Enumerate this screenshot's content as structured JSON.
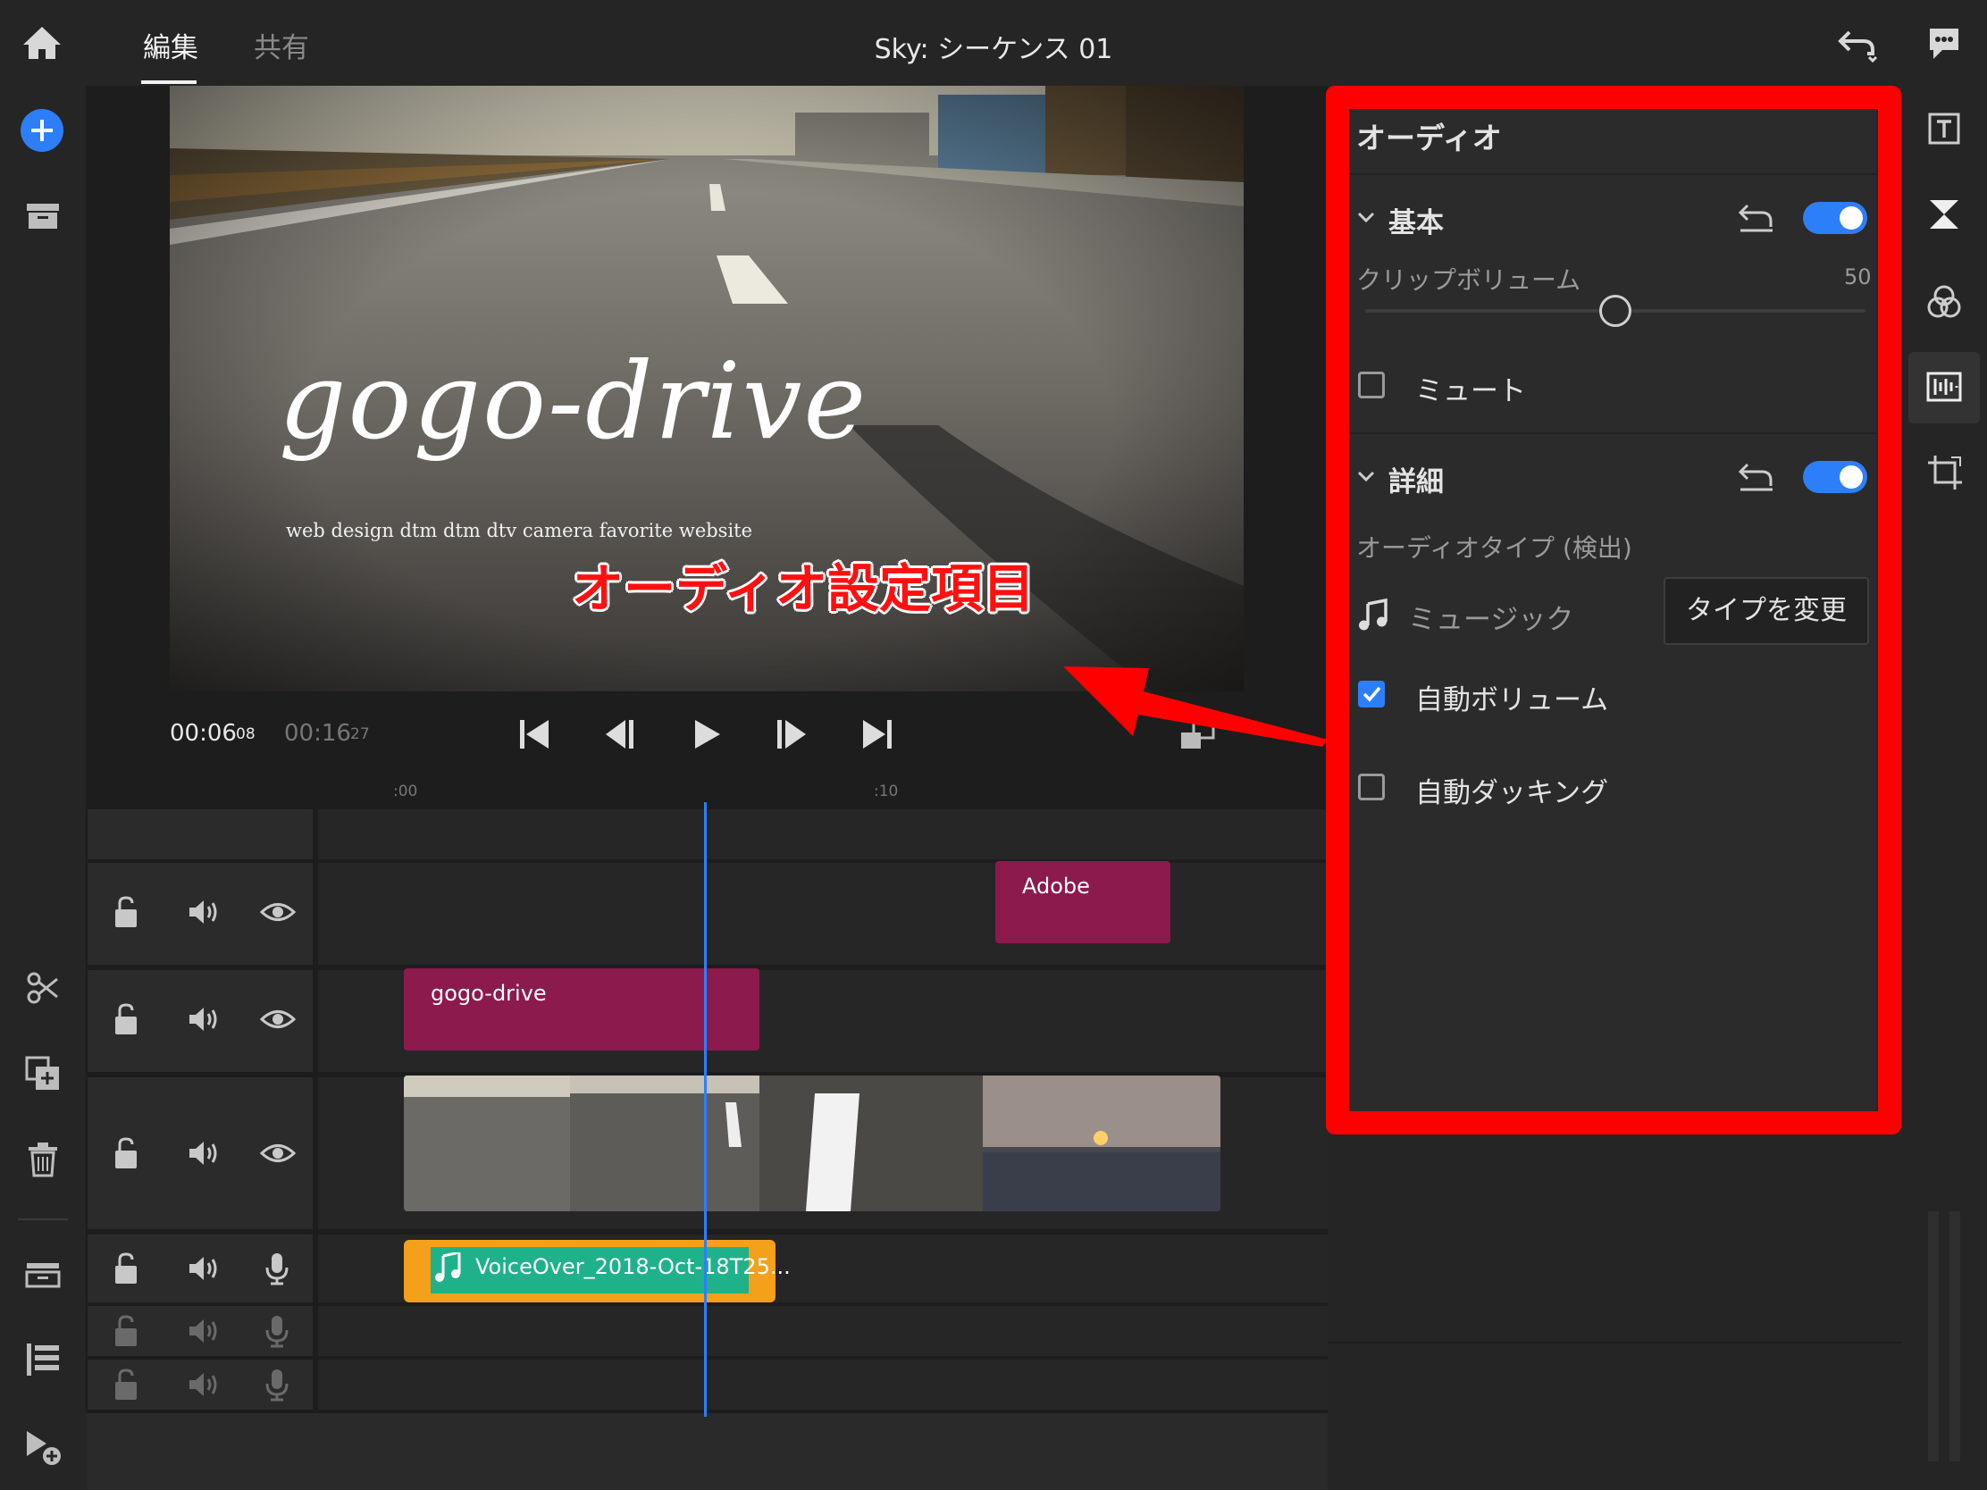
{
  "header": {
    "tabs": [
      {
        "label": "編集",
        "active": true
      },
      {
        "label": "共有",
        "active": false
      }
    ],
    "sequence_title": "Sky: シーケンス 01"
  },
  "preview": {
    "overlay_title": "gogo-drive",
    "overlay_subtitle": "web design dtm dtm dtv camera favorite website",
    "annotation": "オーディオ設定項目"
  },
  "transport": {
    "current_time": "00:06",
    "current_frames": "08",
    "duration_time": "00:16",
    "duration_frames": "27"
  },
  "timeline": {
    "ruler_labels": [
      ":00",
      ":10"
    ],
    "clips": {
      "title_adobe": "Adobe",
      "title_gogo": "gogo-drive",
      "voiceover": "VoiceOver_2018-Oct-18T25..."
    }
  },
  "panel": {
    "title": "オーディオ",
    "basic": {
      "label": "基本",
      "enabled": true,
      "clip_volume_label": "クリップボリューム",
      "clip_volume_value": "50",
      "clip_volume": 50,
      "mute_label": "ミュート",
      "mute": false
    },
    "detail": {
      "label": "詳細",
      "enabled": true,
      "audio_type_label": "オーディオタイプ (検出)",
      "type_value": "ミュージック",
      "change_type_button": "タイプを変更",
      "auto_volume_label": "自動ボリューム",
      "auto_volume": true,
      "auto_ducking_label": "自動ダッキング",
      "auto_ducking": false
    }
  },
  "colors": {
    "accent": "#2d7ff9",
    "title_clip": "#8c1a4d",
    "audio_clip": "#f5a01a",
    "annotation_red": "#ff0000",
    "playhead": "#2d7ff9"
  }
}
